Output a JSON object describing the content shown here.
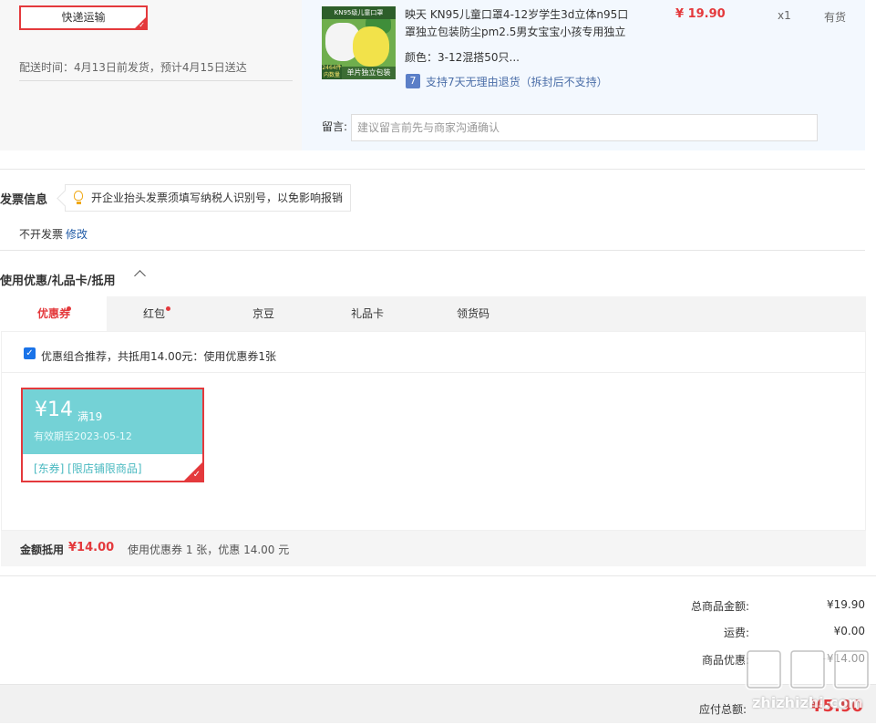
{
  "shipping": {
    "method_label": "快递运输",
    "delivery_time": "配送时间：4月13日前发货，预计4月15日送达"
  },
  "product": {
    "image_band_text": "KN95级儿童口罩",
    "image_badge_text": "2464件 内数量",
    "image_label_text": "单片独立包装",
    "title": "映天 KN95儿童口罩4-12岁学生3d立体n95口罩独立包装防尘pm2.5男女宝宝小孩专用独立",
    "price": "¥ 19.90",
    "quantity": "x1",
    "stock": "有货",
    "color": "颜色：3-12混搭50只...",
    "return_icon": "7",
    "return_policy": "支持7天无理由退货（拆封后不支持）",
    "message_label": "留言:",
    "message_placeholder": "建议留言前先与商家沟通确认"
  },
  "invoice": {
    "title": "发票信息",
    "tip": "开企业抬头发票须填写纳税人识别号，以免影响报销",
    "status": "不开发票",
    "edit_label": "修改"
  },
  "coupons": {
    "title": "使用优惠/礼品卡/抵用",
    "tabs": [
      {
        "label": "优惠券",
        "active": true,
        "dot": true
      },
      {
        "label": "红包",
        "active": false,
        "dot": true
      },
      {
        "label": "京豆",
        "active": false,
        "dot": false
      },
      {
        "label": "礼品卡",
        "active": false,
        "dot": false
      },
      {
        "label": "领货码",
        "active": false,
        "dot": false
      }
    ],
    "combo_checked": true,
    "combo_text": "优惠组合推荐，共抵用14.00元：使用优惠券1张",
    "coupon": {
      "amount": "¥14",
      "condition": "满19",
      "expiry": "有效期至2023-05-12",
      "tags": "[东券]  [限店铺限商品]"
    },
    "summary_label": "金额抵用",
    "summary_amount": "¥14.00",
    "summary_desc": "使用优惠券 1 张，优惠 14.00 元"
  },
  "totals": {
    "goods_label": "总商品金额:",
    "goods_value": "¥19.90",
    "freight_label": "运费:",
    "freight_value": "¥0.00",
    "discount_label": "商品优惠:",
    "discount_value": "-¥14.00",
    "payable_label": "应付总额:",
    "payable_value": "¥5.90"
  },
  "watermark": {
    "text": "值值值",
    "site": "zhizhizhi.com"
  },
  "colors": {
    "accent_red": "#e4393c",
    "coupon_teal": "#74d2d6",
    "link_blue": "#1f5aa6",
    "product_bg": "#f3f8fe"
  }
}
